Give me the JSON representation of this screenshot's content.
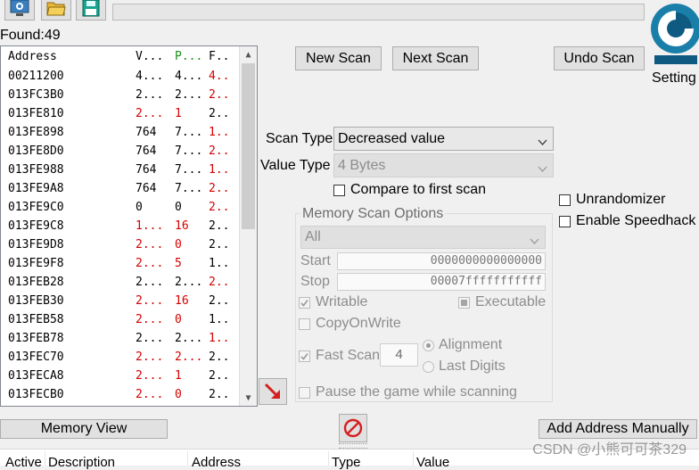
{
  "toolbar": {
    "icons": [
      "process-list-icon",
      "open-file-icon",
      "save-icon"
    ]
  },
  "found_label": "Found:49",
  "settings_label": "Setting",
  "buttons": {
    "new_scan": "New Scan",
    "next_scan": "Next Scan",
    "undo_scan": "Undo Scan",
    "memory_view": "Memory View",
    "add_address": "Add Address Manually"
  },
  "results": {
    "headers": [
      "Address",
      "V...",
      "P...",
      "F.."
    ],
    "rows": [
      {
        "address": "00211200",
        "value": "4...",
        "prev": "4...",
        "first": "4..",
        "red": [
          false,
          false,
          true
        ]
      },
      {
        "address": "013FC3B0",
        "value": "2...",
        "prev": "2...",
        "first": "2..",
        "red": [
          false,
          false,
          true
        ]
      },
      {
        "address": "013FE810",
        "value": "2...",
        "prev": "1",
        "first": "2..",
        "red": [
          true,
          true,
          false
        ]
      },
      {
        "address": "013FE898",
        "value": "764",
        "prev": "7...",
        "first": "1..",
        "red": [
          false,
          false,
          true
        ]
      },
      {
        "address": "013FE8D0",
        "value": "764",
        "prev": "7...",
        "first": "2..",
        "red": [
          false,
          false,
          true
        ]
      },
      {
        "address": "013FE988",
        "value": "764",
        "prev": "7...",
        "first": "1..",
        "red": [
          false,
          false,
          true
        ]
      },
      {
        "address": "013FE9A8",
        "value": "764",
        "prev": "7...",
        "first": "2..",
        "red": [
          false,
          false,
          true
        ]
      },
      {
        "address": "013FE9C0",
        "value": "0",
        "prev": "0",
        "first": "2..",
        "red": [
          false,
          false,
          true
        ]
      },
      {
        "address": "013FE9C8",
        "value": "1...",
        "prev": "16",
        "first": "2..",
        "red": [
          true,
          true,
          false
        ]
      },
      {
        "address": "013FE9D8",
        "value": "2...",
        "prev": "0",
        "first": "2..",
        "red": [
          true,
          true,
          false
        ]
      },
      {
        "address": "013FE9F8",
        "value": "2...",
        "prev": "5",
        "first": "1..",
        "red": [
          true,
          true,
          false
        ]
      },
      {
        "address": "013FEB28",
        "value": "2...",
        "prev": "2...",
        "first": "2..",
        "red": [
          false,
          false,
          true
        ]
      },
      {
        "address": "013FEB30",
        "value": "2...",
        "prev": "16",
        "first": "2..",
        "red": [
          true,
          true,
          false
        ]
      },
      {
        "address": "013FEB58",
        "value": "2...",
        "prev": "0",
        "first": "1..",
        "red": [
          true,
          true,
          false
        ]
      },
      {
        "address": "013FEB78",
        "value": "2...",
        "prev": "2...",
        "first": "1..",
        "red": [
          false,
          false,
          true
        ]
      },
      {
        "address": "013FEC70",
        "value": "2...",
        "prev": "2...",
        "first": "2..",
        "red": [
          true,
          true,
          false
        ]
      },
      {
        "address": "013FECA8",
        "value": "2...",
        "prev": "1",
        "first": "2..",
        "red": [
          true,
          true,
          false
        ]
      },
      {
        "address": "013FECB0",
        "value": "2...",
        "prev": "0",
        "first": "2..",
        "red": [
          true,
          true,
          false
        ]
      }
    ]
  },
  "scan": {
    "scan_type_label": "Scan Type",
    "scan_type_value": "Decreased value",
    "value_type_label": "Value Type",
    "value_type_value": "4 Bytes",
    "compare_first": "Compare to first scan"
  },
  "options": {
    "unrandomizer": "Unrandomizer",
    "speedhack": "Enable Speedhack"
  },
  "memory_scan": {
    "title": "Memory Scan Options",
    "region": "All",
    "start_label": "Start",
    "start_value": "0000000000000000",
    "stop_label": "Stop",
    "stop_value": "00007fffffffffff",
    "writable": "Writable",
    "executable": "Executable",
    "copy_on_write": "CopyOnWrite",
    "fast_scan": "Fast Scan",
    "fast_scan_value": "4",
    "alignment": "Alignment",
    "last_digits": "Last Digits",
    "pause_game": "Pause the game while scanning"
  },
  "address_list_headers": [
    "Active",
    "Description",
    "Address",
    "Type",
    "Value"
  ],
  "watermark": "CSDN @小熊可可茶329",
  "colors": {
    "red_value": "#d40000",
    "selected_prev": "#1a8f1a"
  }
}
